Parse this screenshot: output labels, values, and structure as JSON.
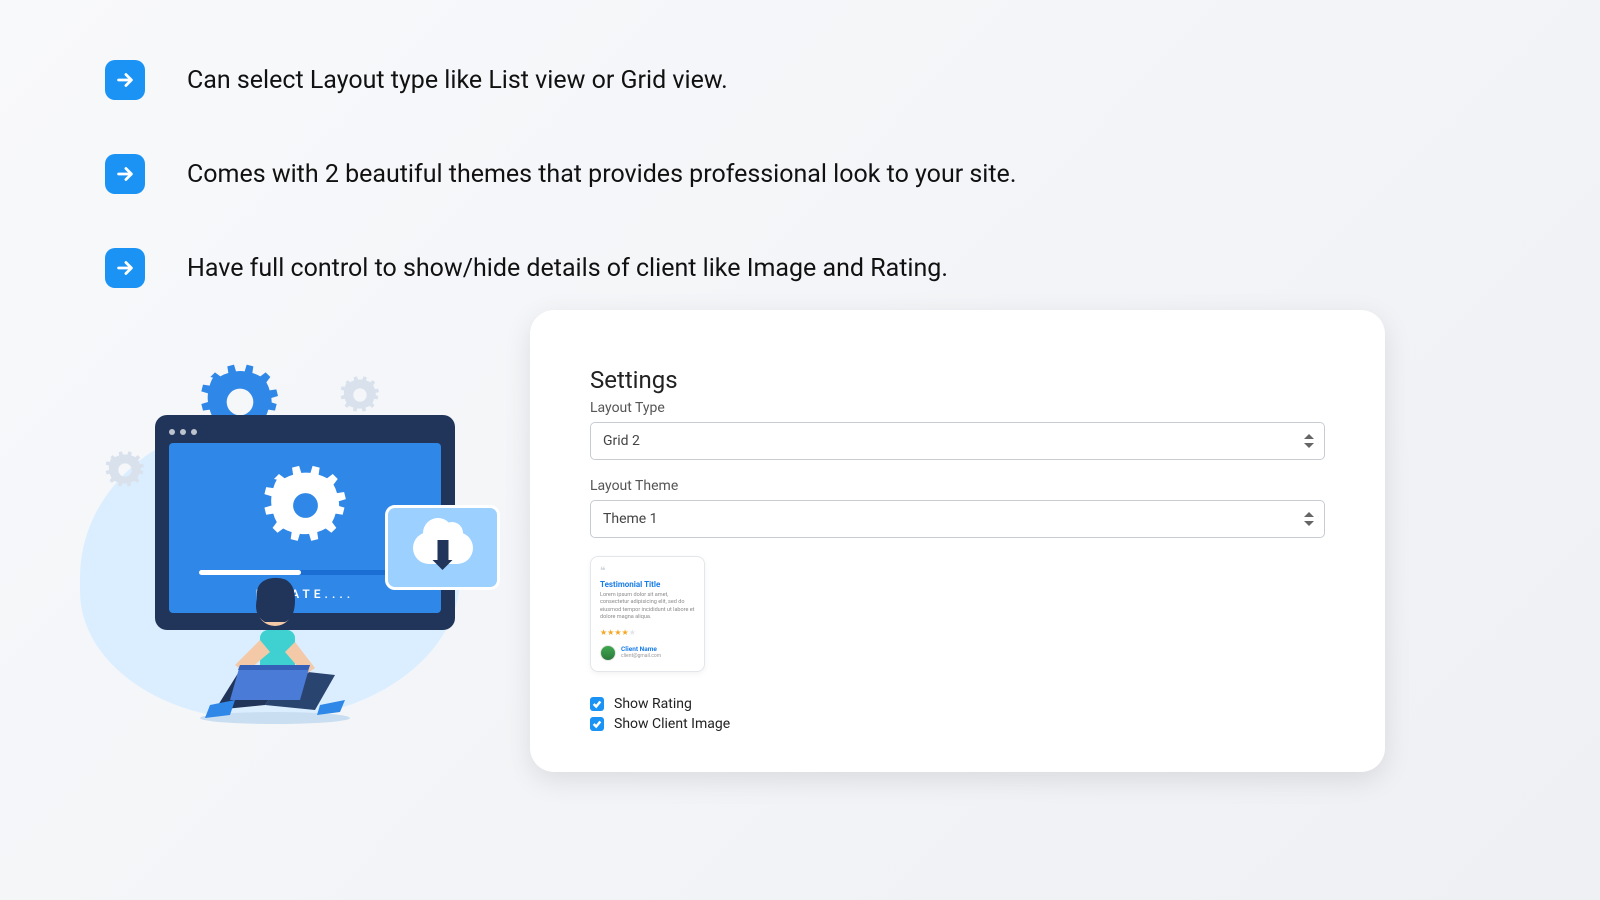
{
  "features": [
    "Can select Layout type like List view or Grid view.",
    "Comes with 2 beautiful themes that provides professional look to your site.",
    "Have full control to show/hide details of client like Image and Rating."
  ],
  "illustration": {
    "update_label": "UPDATE...."
  },
  "settings": {
    "title": "Settings",
    "layout_type_label": "Layout Type",
    "layout_type_value": "Grid 2",
    "layout_theme_label": "Layout Theme",
    "layout_theme_value": "Theme 1",
    "preview": {
      "title": "Testimonial Title",
      "body": "Lorem ipsum dolor sit amet, consectetur adipisicing elit, sed do eiusmod tempor incididunt ut labore et dolore magna aliqua.",
      "client_name": "Client Name",
      "client_email": "client@gmail.com"
    },
    "show_rating_label": "Show Rating",
    "show_client_image_label": "Show Client Image"
  }
}
